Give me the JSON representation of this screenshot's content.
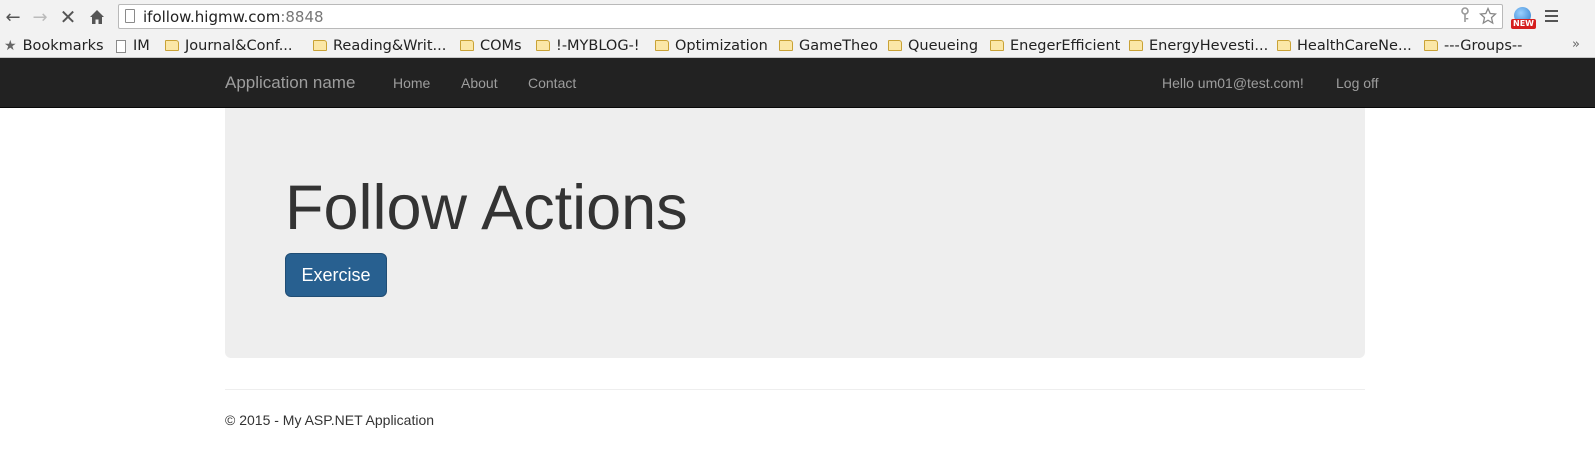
{
  "browser": {
    "url_host": "ifollow.higmw.com",
    "url_port": ":8848",
    "ext_badge": "NEW",
    "icons": {
      "back": "arrow-left",
      "forward": "arrow-right",
      "stop": "close-x",
      "home": "house",
      "key": "key",
      "star": "star",
      "menu": "hamburger"
    }
  },
  "bookmarks": {
    "label": "Bookmarks",
    "items": [
      {
        "label": "IM",
        "type": "page"
      },
      {
        "label": "Journal&Conf...",
        "type": "folder"
      },
      {
        "label": "Reading&Writ...",
        "type": "folder"
      },
      {
        "label": "COMs",
        "type": "folder"
      },
      {
        "label": "!-MYBLOG-!",
        "type": "folder"
      },
      {
        "label": "Optimization",
        "type": "folder"
      },
      {
        "label": "GameTheo",
        "type": "folder"
      },
      {
        "label": "Queueing",
        "type": "folder"
      },
      {
        "label": "EnegerEfficient",
        "type": "folder"
      },
      {
        "label": "EnergyHevesti...",
        "type": "folder"
      },
      {
        "label": "HealthCareNe...",
        "type": "folder"
      },
      {
        "label": "---Groups--",
        "type": "folder"
      }
    ],
    "overflow": "»"
  },
  "navbar": {
    "brand": "Application name",
    "links": [
      "Home",
      "About",
      "Contact"
    ],
    "greeting": "Hello um01@test.com!",
    "logoff": "Log off",
    "background": "#222222",
    "link_color": "#9d9d9d"
  },
  "jumbotron": {
    "title": "Follow Actions",
    "button": "Exercise",
    "button_color": "#286090"
  },
  "footer": {
    "text": "© 2015 - My ASP.NET Application"
  }
}
